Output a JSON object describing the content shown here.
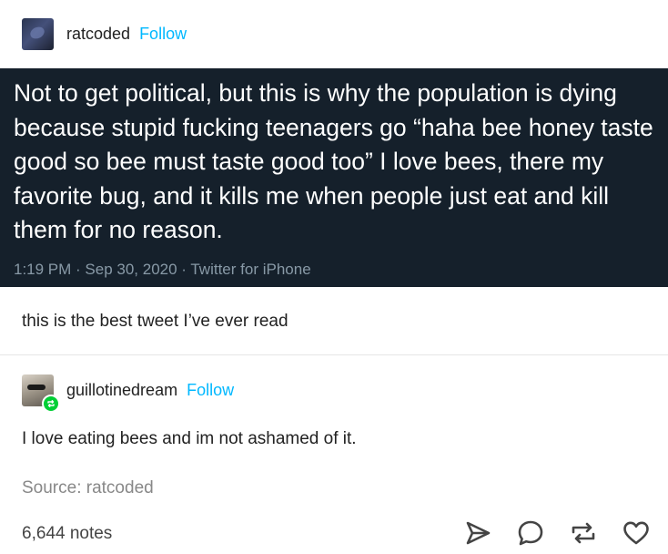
{
  "original_post": {
    "username": "ratcoded",
    "follow_label": "Follow"
  },
  "tweet": {
    "text": "Not to get political, but this is why the population is dying because stupid fucking teenagers go “haha bee honey taste good so bee must taste good too” I love bees, there my favorite bug, and it kills me when people just eat and kill them for no reason.",
    "meta": "1:19 PM · Sep 30, 2020 · Twitter for iPhone"
  },
  "comment_1": {
    "text": "this is the best tweet I’ve ever read"
  },
  "reblog": {
    "username": "guillotinedream",
    "follow_label": "Follow",
    "text": "I love eating bees and im not ashamed of it."
  },
  "footer": {
    "source": "Source: ratcoded",
    "notes": "6,644 notes",
    "actions": [
      "send-icon",
      "comment-icon",
      "reblog-icon",
      "like-icon"
    ]
  },
  "colors": {
    "follow": "#00b8ff",
    "tweet_bg": "#15202b",
    "tweet_meta": "#8899a6",
    "reblog_badge": "#00cf35"
  }
}
